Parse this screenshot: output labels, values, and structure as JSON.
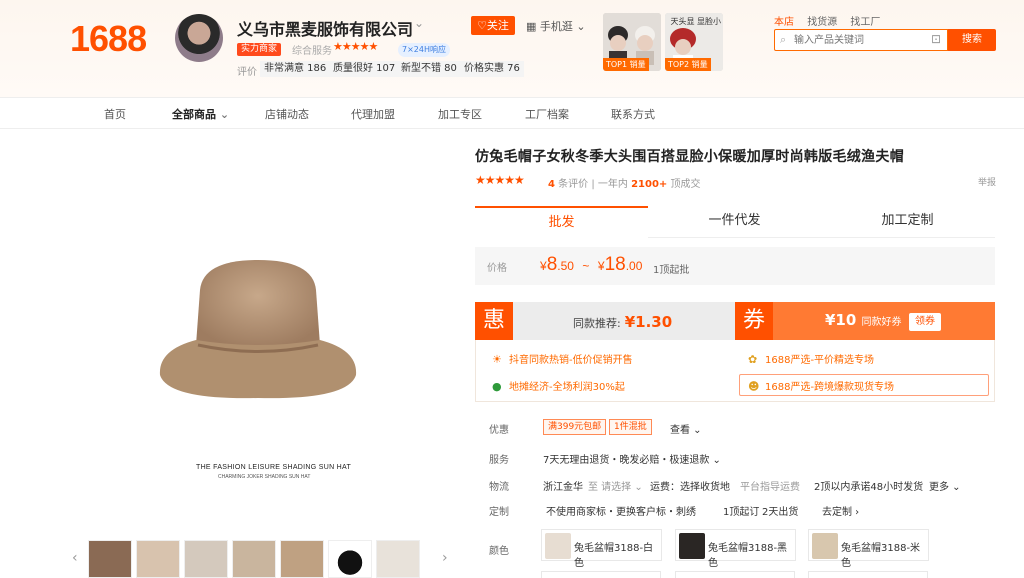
{
  "site": {
    "logo": "1688"
  },
  "shop": {
    "name": "义乌市黑麦服饰有限公司",
    "dropdown": "⌄",
    "badge_shili": "实力商家",
    "zonghe_label": "综合服务",
    "stars": "★★★★★",
    "badge_resp": "7×24H响应",
    "eval_label": "评价",
    "evals": [
      "非常满意 186",
      "质量很好 107",
      "新型不错 80",
      "价格实惠 76"
    ],
    "follow": "♡关注",
    "mobile": "▦ 手机逛 ⌄"
  },
  "top_products": [
    {
      "tag": "TOP1 销量",
      "sub": ""
    },
    {
      "tag": "TOP2 销量",
      "sub": "天头显 显脸小"
    }
  ],
  "search": {
    "tabs": [
      "本店",
      "找货源",
      "找工厂"
    ],
    "placeholder": "输入产品关键词",
    "button": "搜索"
  },
  "nav": {
    "items": [
      "首页",
      "全部商品",
      "店铺动态",
      "代理加盟",
      "加工专区",
      "工厂档案",
      "联系方式"
    ],
    "active_suffix": "⌄"
  },
  "gallery": {
    "caption1": "THE FASHION LEISURE SHADING SUN HAT",
    "caption2": "CHARMING JOKER SHADING SUN HAT",
    "prev": "‹",
    "next": "›"
  },
  "product": {
    "title": "仿兔毛帽子女秋冬季大头围百搭显脸小保暖加厚时尚韩版毛绒渔夫帽",
    "rating_stars": "★★★★★",
    "review_count": "4",
    "review_label": "条评价",
    "sales_period": "一年内",
    "sales_count": "2100+",
    "sales_label": "顶成交",
    "report": "举报"
  },
  "tabs": [
    "批发",
    "一件代发",
    "加工定制"
  ],
  "price": {
    "label": "价格",
    "min_int": "8",
    "min_dec": ".50",
    "sep": "~",
    "max_int": "18",
    "max_dec": ".00",
    "currency": "¥",
    "unit": "1顶起批"
  },
  "promo": {
    "hui": "惠",
    "hui_label": "同款推荐:",
    "hui_price": "¥1.30",
    "quan": "券",
    "quan_amount": "¥10",
    "quan_label": "同款好券",
    "quan_btn": "领券"
  },
  "activities": [
    {
      "text": "抖音同款热销-低价促销开售",
      "icon": "☀"
    },
    {
      "text": "1688严选-平价精选专场",
      "icon": "✿"
    },
    {
      "text": "地摊经济-全场利润30%起",
      "icon": "●"
    },
    {
      "text": "1688严选-跨境爆款现货专场",
      "icon": "☻"
    }
  ],
  "details": {
    "discount_label": "优惠",
    "discount_tags": [
      "满399元包邮",
      "1件混批"
    ],
    "discount_more": "查看 ⌄",
    "service_label": "服务",
    "service_val": "7天无理由退货・晚发必赔・极速退款 ⌄",
    "logistics_label": "物流",
    "logistics_from": "浙江金华",
    "logistics_to": "至 请选择 ⌄",
    "logistics_fee": "运费：选择收货地",
    "logistics_platform": "平台指导运费",
    "logistics_ship": "2顶以内承诺48小时发货",
    "logistics_more": "更多 ⌄",
    "custom_label": "定制",
    "custom_val": "不使用商家标・更换客户标・刺绣",
    "custom_min": "1顶起订",
    "custom_days": "2天出货",
    "custom_link": "去定制 ›",
    "color_label": "颜色",
    "colors": [
      {
        "name": "兔毛盆帽3188-白色",
        "swatch": "#e7ddd2"
      },
      {
        "name": "兔毛盆帽3188-黑色",
        "swatch": "#2a2624"
      },
      {
        "name": "兔毛盆帽3188-米色",
        "swatch": "#d8c7ae"
      }
    ]
  },
  "colors": {
    "accent": "#ff5000",
    "accent_light": "#ff7a33"
  }
}
